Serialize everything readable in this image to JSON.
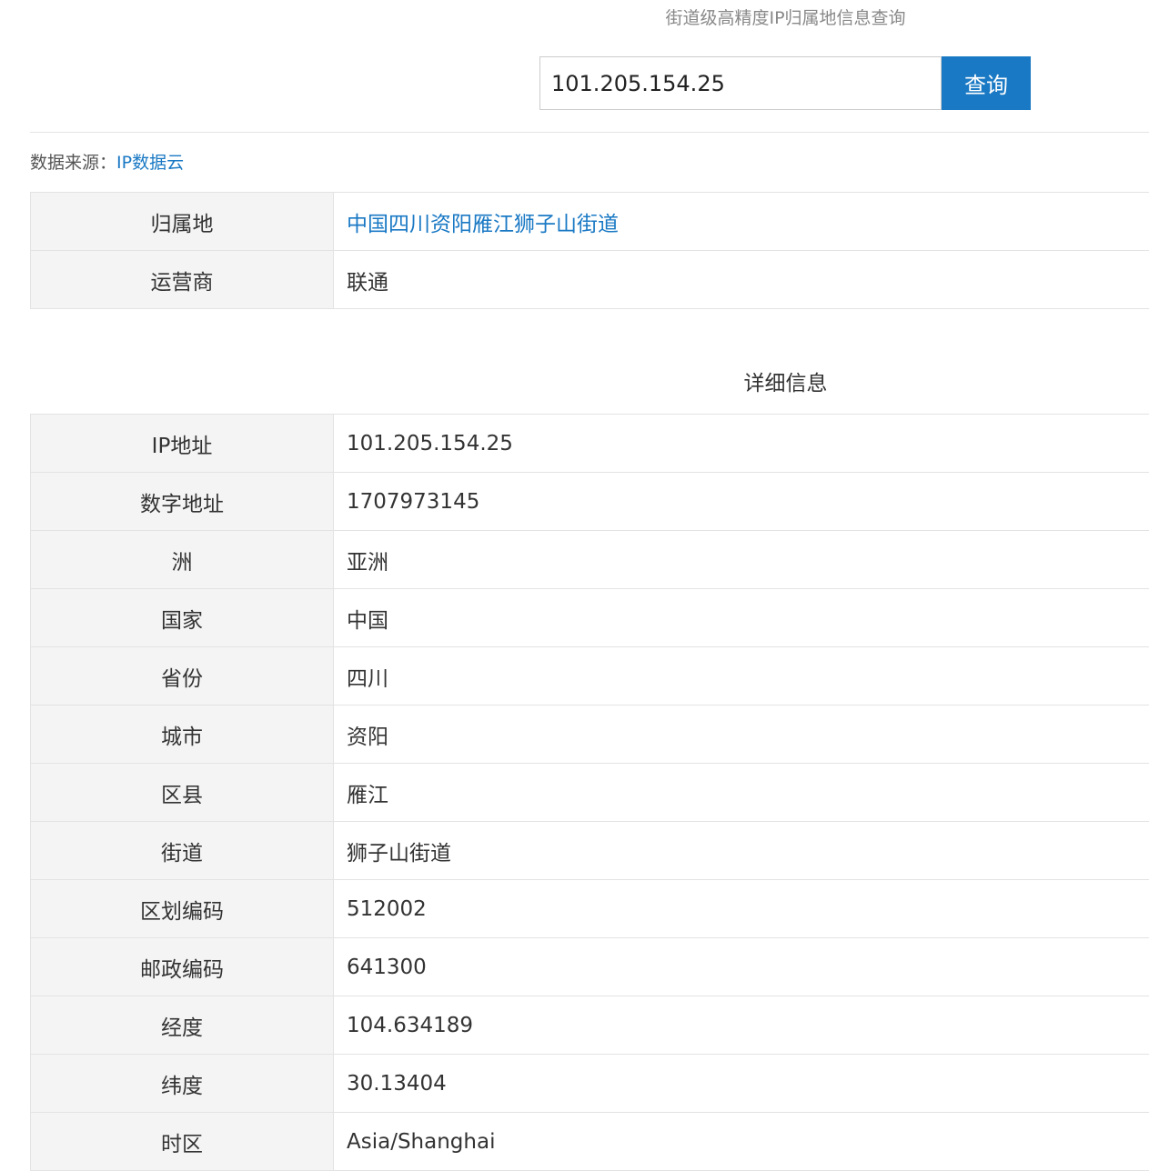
{
  "header": {
    "subtitle": "街道级高精度IP归属地信息查询"
  },
  "search": {
    "value": "101.205.154.25",
    "button_label": "查询"
  },
  "source": {
    "label": "数据来源：",
    "link": "IP数据云"
  },
  "summary": [
    {
      "label": "归属地",
      "value": "中国四川资阳雁江狮子山街道"
    },
    {
      "label": "运营商",
      "value": "联通"
    }
  ],
  "details_title": "详细信息",
  "details": [
    {
      "label": "IP地址",
      "value": "101.205.154.25"
    },
    {
      "label": "数字地址",
      "value": "1707973145"
    },
    {
      "label": "洲",
      "value": "亚洲"
    },
    {
      "label": "国家",
      "value": "中国"
    },
    {
      "label": "省份",
      "value": "四川"
    },
    {
      "label": "城市",
      "value": "资阳"
    },
    {
      "label": "区县",
      "value": "雁江"
    },
    {
      "label": "街道",
      "value": "狮子山街道"
    },
    {
      "label": "区划编码",
      "value": "512002"
    },
    {
      "label": "邮政编码",
      "value": "641300"
    },
    {
      "label": "经度",
      "value": "104.634189"
    },
    {
      "label": "纬度",
      "value": "30.13404"
    },
    {
      "label": "时区",
      "value": "Asia/Shanghai"
    }
  ],
  "colors": {
    "accent": "#1a79c4",
    "label_background": "#f4f4f4"
  }
}
